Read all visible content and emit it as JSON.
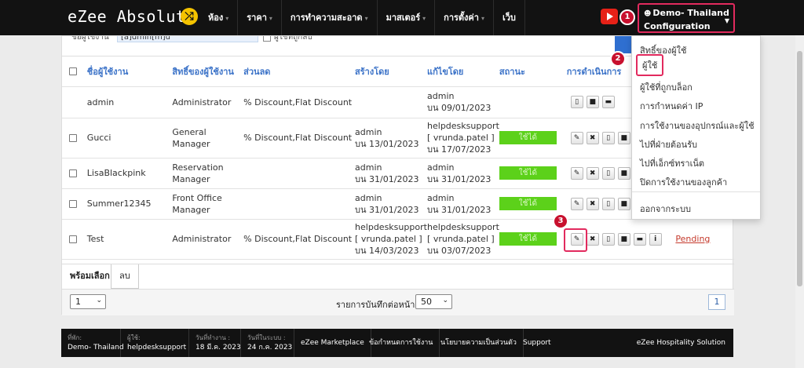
{
  "header": {
    "logo": "eZee Absolute",
    "menu": [
      "ห้อง",
      "ราคา",
      "การทำความสะอาด",
      "มาสเตอร์",
      "การตั้งค่า",
      "เว็บ"
    ],
    "user_name": "Demo- Thailand",
    "user_sub": "Configuration",
    "colors": {
      "bar": "#121212",
      "highlight": "#e22a5e",
      "logo_mark": "#f4c300"
    }
  },
  "badges": [
    "1",
    "2",
    "3"
  ],
  "filter": {
    "label": "ชื่อผู้ใช้งาน",
    "value": "[a]dmin[m]u",
    "check_label": "ผู้ใช้ที่ถูกลบ"
  },
  "table": {
    "columns": [
      "ชื่อผู้ใช้งาน",
      "สิทธิ์ของผู้ใช้งาน",
      "ส่วนลด",
      "สร้างโดย",
      "แก้ไขโดย",
      "สถานะ",
      "การดำเนินการ"
    ],
    "rows": [
      {
        "user": "admin",
        "role": "Administrator",
        "discount": "% Discount,Flat Discount",
        "created_by": "",
        "created_on": "",
        "modified_by": "admin",
        "modified_on": "บน 09/01/2023",
        "status": "",
        "actions": [
          "mobile-icon",
          "lock-icon",
          "comment-icon"
        ],
        "extra": ""
      },
      {
        "user": "Gucci",
        "role": "General Manager",
        "discount": "% Discount,Flat Discount",
        "created_by": "admin",
        "created_on": "บน 13/01/2023",
        "modified_by": "helpdesksupport [ vrunda.patel ]",
        "modified_on": "บน 17/07/2023",
        "status": "ใช้ได้",
        "actions": [
          "pencil-icon",
          "delete-icon",
          "mobile-icon",
          "lock-icon"
        ],
        "extra": ""
      },
      {
        "user": "LisaBlackpink",
        "role": "Reservation Manager",
        "discount": "",
        "created_by": "admin",
        "created_on": "บน 31/01/2023",
        "modified_by": "admin",
        "modified_on": "บน 31/01/2023",
        "status": "ใช้ได้",
        "actions": [
          "pencil-icon",
          "delete-icon",
          "mobile-icon",
          "lock-icon"
        ],
        "extra": ""
      },
      {
        "user": "Summer12345",
        "role": "Front Office Manager",
        "discount": "",
        "created_by": "admin",
        "created_on": "บน 31/01/2023",
        "modified_by": "admin",
        "modified_on": "บน 31/01/2023",
        "status": "ใช้ได้",
        "actions": [
          "pencil-icon",
          "delete-icon",
          "mobile-icon",
          "lock-icon"
        ],
        "extra": ""
      },
      {
        "user": "Test",
        "role": "Administrator",
        "discount": "% Discount,Flat Discount",
        "created_by": "helpdesksupport [ vrunda.patel ]",
        "created_on": "บน 14/03/2023",
        "modified_by": "helpdesksupport [ vrunda.patel ]",
        "modified_on": "บน 03/07/2023",
        "status": "ใช้ได้",
        "actions": [
          "pencil-icon",
          "delete-icon",
          "mobile-icon",
          "lock-icon",
          "comment-icon",
          "info-icon"
        ],
        "extra": "Pending"
      }
    ]
  },
  "footer_tabs": {
    "selected": "พร้อมเลือก",
    "delete": "ลบ"
  },
  "pager": {
    "page": "1",
    "per_page_label": "รายการบันทึกต่อหน้า",
    "per_page": "50",
    "current_page_btn": "1"
  },
  "dropdown": [
    "สิทธิ์ของผู้ใช้",
    "ผู้ใช้",
    "ผู้ใช้ที่ถูกบล็อก",
    "การกำหนดค่า IP",
    "การใช้งานของอุปกรณ์และผู้ใช้",
    "ไปที่ฝ่ายต้อนรับ",
    "ไปที่เอ็กซ์ทราเน็ต",
    "ปิดการใช้งานของลูกค้า",
    "ออกจากระบบ"
  ],
  "statusbar": {
    "cells": [
      {
        "k": "ที่พัก:",
        "v": "Demo- Thailand"
      },
      {
        "k": "ผู้ใช้:",
        "v": "helpdesksupport"
      },
      {
        "k": "วันที่ทำงาน :",
        "v": "18 มี.ค. 2023"
      },
      {
        "k": "วันที่ในระบบ :",
        "v": "24 ก.ค. 2023"
      }
    ],
    "links": [
      "eZee Marketplace",
      "ข้อกำหนดการใช้งาน",
      "นโยบายความเป็นส่วนตัว",
      "Support"
    ],
    "brand": "eZee Hospitality Solution"
  }
}
